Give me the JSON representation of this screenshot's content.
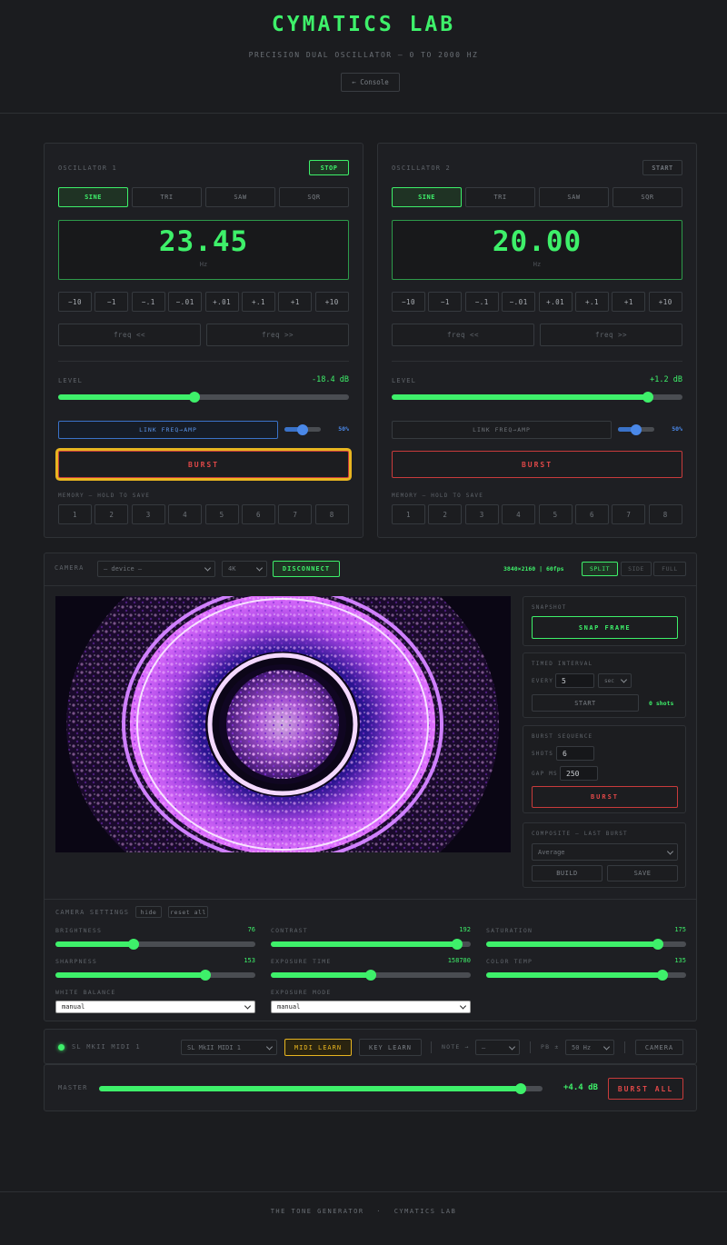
{
  "header": {
    "title": "CYMATICS LAB",
    "subtitle": "PRECISION DUAL OSCILLATOR — 0 TO 2000 HZ",
    "console_label": "← Console"
  },
  "oscillators": [
    {
      "title": "OSCILLATOR 1",
      "toggle_label": "STOP",
      "waveforms": [
        "SINE",
        "TRI",
        "SAW",
        "SQR"
      ],
      "active_waveform": "SINE",
      "frequency": "23.45",
      "unit": "Hz",
      "steps": [
        "−10",
        "−1",
        "−.1",
        "−.01",
        "+.01",
        "+.1",
        "+1",
        "+10"
      ],
      "freq_prev": "freq <<",
      "freq_next": "freq >>",
      "level_label": "LEVEL",
      "level_value": "-18.4 dB",
      "level_fraction": 0.47,
      "link_label": "LINK FREQ→AMP",
      "link_pct": "50%",
      "link_fraction": 0.5,
      "burst_label": "BURST",
      "memory_label": "MEMORY — HOLD TO SAVE",
      "memory_slots": [
        "1",
        "2",
        "3",
        "4",
        "5",
        "6",
        "7",
        "8"
      ]
    },
    {
      "title": "OSCILLATOR 2",
      "toggle_label": "START",
      "waveforms": [
        "SINE",
        "TRI",
        "SAW",
        "SQR"
      ],
      "active_waveform": "SINE",
      "frequency": "20.00",
      "unit": "Hz",
      "steps": [
        "−10",
        "−1",
        "−.1",
        "−.01",
        "+.01",
        "+.1",
        "+1",
        "+10"
      ],
      "freq_prev": "freq <<",
      "freq_next": "freq >>",
      "level_label": "LEVEL",
      "level_value": "+1.2 dB",
      "level_fraction": 0.88,
      "link_label": "LINK FREQ→AMP",
      "link_pct": "50%",
      "link_fraction": 0.5,
      "burst_label": "BURST",
      "memory_label": "MEMORY — HOLD TO SAVE",
      "memory_slots": [
        "1",
        "2",
        "3",
        "4",
        "5",
        "6",
        "7",
        "8"
      ]
    }
  ],
  "camera": {
    "label": "CAMERA",
    "device_placeholder": "— device —",
    "resolution": "4K",
    "disconnect_label": "DISCONNECT",
    "status": "3840×2160 | 60fps",
    "view_modes": [
      "SPLIT",
      "SIDE",
      "FULL"
    ],
    "active_view": "SPLIT",
    "snapshot": {
      "label": "SNAPSHOT",
      "button": "SNAP FRAME"
    },
    "timed": {
      "label": "TIMED INTERVAL",
      "every_label": "EVERY",
      "every_value": "5",
      "unit": "sec",
      "start_label": "START",
      "shots": "0 shots"
    },
    "burst_seq": {
      "label": "BURST SEQUENCE",
      "shots_label": "SHOTS",
      "shots_value": "6",
      "gap_label": "GAP MS",
      "gap_value": "250",
      "button": "BURST"
    },
    "composite": {
      "label": "COMPOSITE — LAST BURST",
      "mode": "Average",
      "build_label": "BUILD",
      "save_label": "SAVE"
    }
  },
  "camera_settings": {
    "label": "CAMERA SETTINGS",
    "hide_label": "hide",
    "reset_label": "reset all",
    "sliders": [
      {
        "name": "BRIGHTNESS",
        "value": "76",
        "fraction": 0.39
      },
      {
        "name": "CONTRAST",
        "value": "192",
        "fraction": 0.93
      },
      {
        "name": "SATURATION",
        "value": "175",
        "fraction": 0.86
      },
      {
        "name": "SHARPNESS",
        "value": "153",
        "fraction": 0.75
      },
      {
        "name": "EXPOSURE TIME",
        "value": "158780",
        "fraction": 0.5
      },
      {
        "name": "COLOR TEMP",
        "value": "135",
        "fraction": 0.88
      }
    ],
    "white_balance_label": "WHITE BALANCE",
    "white_balance_value": "manual",
    "exposure_mode_label": "EXPOSURE MODE",
    "exposure_mode_value": "manual"
  },
  "midi": {
    "device_label": "SL MKII MIDI 1",
    "device_select": "SL MkII MIDI 1",
    "midi_learn": "MIDI LEARN",
    "key_learn": "KEY LEARN",
    "note_label": "NOTE →",
    "note_value": "—",
    "pb_label": "PB ±",
    "pb_value": "50 Hz",
    "camera_label": "CAMERA"
  },
  "master": {
    "label": "MASTER",
    "value": "+4.4 dB",
    "fraction": 0.95,
    "burst_all": "BURST ALL"
  },
  "footer": {
    "left": "THE TONE GENERATOR",
    "sep": "·",
    "right": "CYMATICS LAB"
  }
}
